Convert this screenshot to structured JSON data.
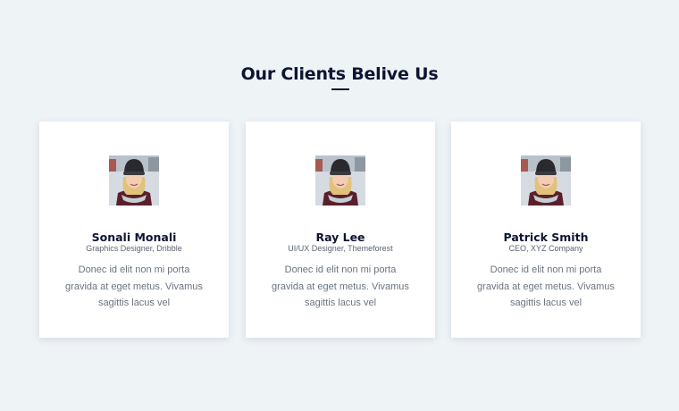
{
  "section": {
    "title": "Our Clients Belive Us"
  },
  "colors": {
    "background": "#eef3f6",
    "card": "#ffffff",
    "heading": "#0d1533",
    "body_text": "#6b7480"
  },
  "testimonials": [
    {
      "name": "Sonali Monali",
      "role": "Graphics Designer, Dribble",
      "quote": "Donec id elit non mi porta gravida at eget metus. Vivamus sagittis lacus vel",
      "avatar_icon": "user-photo"
    },
    {
      "name": "Ray Lee",
      "role": "UI/UX Designer, Themeforest",
      "quote": "Donec id elit non mi porta gravida at eget metus. Vivamus sagittis lacus vel",
      "avatar_icon": "user-photo"
    },
    {
      "name": "Patrick Smith",
      "role": "CEO, XYZ Company",
      "quote": "Donec id elit non mi porta gravida at eget metus. Vivamus sagittis lacus vel",
      "avatar_icon": "user-photo"
    }
  ]
}
